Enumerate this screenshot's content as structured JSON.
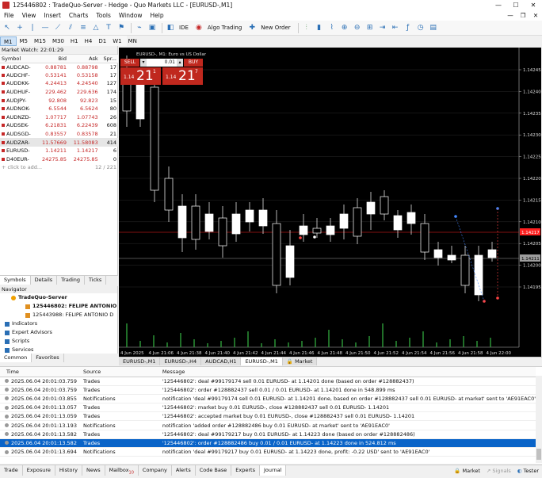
{
  "window": {
    "title": "125446802 : TradeQuo-Server - Hedge - Quo Markets LLC - [EURUSD-,M1]"
  },
  "menu": [
    "File",
    "View",
    "Insert",
    "Charts",
    "Tools",
    "Window",
    "Help"
  ],
  "toolbar": {
    "ide": "IDE",
    "algo_trading": "Algo Trading",
    "new_order": "New Order"
  },
  "timeframes": [
    {
      "label": "M1",
      "active": true
    },
    {
      "label": "M5"
    },
    {
      "label": "M15"
    },
    {
      "label": "M30"
    },
    {
      "label": "H1"
    },
    {
      "label": "H4"
    },
    {
      "label": "D1"
    },
    {
      "label": "W1"
    },
    {
      "label": "MN"
    }
  ],
  "market_watch": {
    "header": "Market Watch: 22:01:29",
    "columns": [
      "Symbol",
      "Bid",
      "Ask",
      "Spr..."
    ],
    "rows": [
      {
        "symbol": "AUDCAD-",
        "bid": "0.88781",
        "ask": "0.88798",
        "spread": "17"
      },
      {
        "symbol": "AUDCHF-",
        "bid": "0.53141",
        "ask": "0.53158",
        "spread": "17"
      },
      {
        "symbol": "AUDDKK-",
        "bid": "4.24413",
        "ask": "4.24540",
        "spread": "127"
      },
      {
        "symbol": "AUDHUF-",
        "bid": "229.462",
        "ask": "229.636",
        "spread": "174"
      },
      {
        "symbol": "AUDJPY-",
        "bid": "92.808",
        "ask": "92.823",
        "spread": "15"
      },
      {
        "symbol": "AUDNOK-",
        "bid": "6.5544",
        "ask": "6.5624",
        "spread": "80"
      },
      {
        "symbol": "AUDNZD-",
        "bid": "1.07717",
        "ask": "1.07743",
        "spread": "26"
      },
      {
        "symbol": "AUDSEK-",
        "bid": "6.21831",
        "ask": "6.22439",
        "spread": "608"
      },
      {
        "symbol": "AUDSGD-",
        "bid": "0.83557",
        "ask": "0.83578",
        "spread": "21"
      },
      {
        "symbol": "AUDZAR-",
        "bid": "11.57669",
        "ask": "11.58083",
        "spread": "414",
        "selected": true
      },
      {
        "symbol": "EURUSD-",
        "bid": "1.14211",
        "ask": "1.14217",
        "spread": "6"
      },
      {
        "symbol": "D40EUR-",
        "bid": "24275.85",
        "ask": "24275.85",
        "spread": "0"
      }
    ],
    "add_row": {
      "label": "+ click to add...",
      "count": "12 / 221"
    },
    "tabs": [
      "Symbols",
      "Details",
      "Trading",
      "Ticks"
    ]
  },
  "navigator": {
    "header": "Navigator",
    "server": "TradeQuo-Server",
    "accounts": [
      "125446802: FELIPE ANTONIO",
      "125443988: FELIPE ANTONIO D"
    ],
    "items": [
      "Indicators",
      "Expert Advisors",
      "Scripts",
      "Services"
    ],
    "tabs": [
      "Common",
      "Favorites"
    ]
  },
  "chart": {
    "label": "EURUSD-, M1:  Euro vs US Dollar",
    "trade_panel": {
      "sell": "SELL",
      "buy": "BUY",
      "volume": "0.01",
      "sell_price_prefix": "1.14",
      "sell_price_big": "21",
      "sell_price_sup": "1",
      "buy_price_prefix": "1.14",
      "buy_price_big": "21",
      "buy_price_sup": "7"
    },
    "price_labels": [
      "1.14245",
      "1.14240",
      "1.14235",
      "1.14230",
      "1.14225",
      "1.14220",
      "1.14215",
      "1.14210",
      "1.14205",
      "1.14200",
      "1.14195"
    ],
    "ask_tag": "1.14217",
    "bid_tag": "1.14211",
    "time_labels": [
      "4 Jun 2025",
      "4 Jun 21:06",
      "4 Jun 21:38",
      "4 Jun 21:40",
      "4 Jun 21:42",
      "4 Jun 21:44",
      "4 Jun 21:46",
      "4 Jun 21:48",
      "4 Jun 21:50",
      "4 Jun 21:52",
      "4 Jun 21:54",
      "4 Jun 21:56",
      "4 Jun 21:58",
      "4 Jun 22:00"
    ],
    "tabs": [
      "EURUSD-,M1",
      "EURUSD-,H4",
      "AUDCAD,H1",
      "EURUSD-,M1",
      "Market"
    ],
    "active_tab": 3,
    "colors": {
      "up": "#ffffff",
      "down": "#000000",
      "grid": "#2a2a2a",
      "ask": "#ff2020",
      "bid": "#9e9e9e"
    }
  },
  "journal": {
    "columns": [
      "Time",
      "Source",
      "Message"
    ],
    "rows": [
      {
        "time": "2025.06.04 20:01:03.759",
        "source": "Trades",
        "message": "'125446802': deal #99179174 sell 0.01 EURUSD- at 1.14201 done (based on order #128882437)"
      },
      {
        "time": "2025.06.04 20:01:03.759",
        "source": "Trades",
        "message": "'125446802': order #128882437 sell 0.01 / 0.01 EURUSD- at 1.14201 done in 548.899 ms"
      },
      {
        "time": "2025.06.04 20:01:03.855",
        "source": "Notifications",
        "message": "notification 'deal #99179174 sell 0.01 EURUSD- at 1.14201 done, based on order #128882437 sell 0.01 EURUSD- at market' sent to 'AE91EAC0'"
      },
      {
        "time": "2025.06.04 20:01:13.057",
        "source": "Trades",
        "message": "'125446802': market buy 0.01 EURUSD-, close #128882437 sell 0.01 EURUSD- 1.14201"
      },
      {
        "time": "2025.06.04 20:01:13.059",
        "source": "Trades",
        "message": "'125446802': accepted market buy 0.01 EURUSD-, close #128882437 sell 0.01 EURUSD- 1.14201"
      },
      {
        "time": "2025.06.04 20:01:13.193",
        "source": "Notifications",
        "message": "notification 'added order #128882486 buy 0.01 EURUSD- at market' sent to 'AE91EAC0'"
      },
      {
        "time": "2025.06.04 20:01:13.582",
        "source": "Trades",
        "message": "'125446802': deal #99179217 buy 0.01 EURUSD- at 1.14223 done (based on order #128882486)"
      },
      {
        "time": "2025.06.04 20:01:13.582",
        "source": "Trades",
        "message": "'125446802': order #128882486 buy 0.01 / 0.01 EURUSD- at 1.14223 done in 524.812 ms",
        "selected": true
      },
      {
        "time": "2025.06.04 20:01:13.694",
        "source": "Notifications",
        "message": "notification 'deal #99179217 buy 0.01 EURUSD- at 1.14223 done, profit: -0.22 USD' sent to 'AE91EAC0'"
      }
    ]
  },
  "bottom_tabs": [
    "Trade",
    "Exposure",
    "History",
    "News",
    "Mailbox",
    "Company",
    "Alerts",
    "Code Base",
    "Experts",
    "Journal"
  ],
  "mailbox_badge": "10",
  "active_bottom": "Journal",
  "status_right": [
    "Market",
    "Signals",
    "Tester"
  ]
}
